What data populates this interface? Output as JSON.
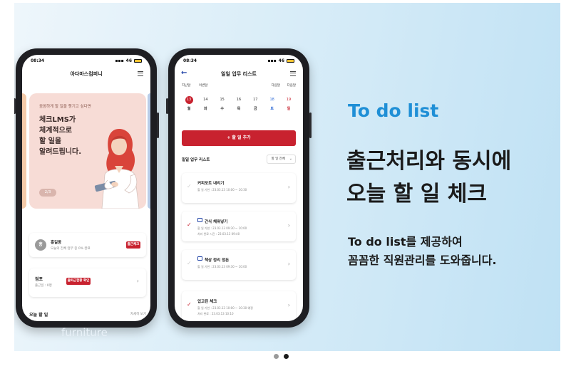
{
  "phone1": {
    "time": "08:34",
    "signal": "46",
    "app_title": "아다마스컴퍼니",
    "hero": {
      "small_text": "꼼꼼하게 할 일을 챙기고 싶다면",
      "big_text": "체크LMS가\n체계적으로\n할 일을\n알려드립니다.",
      "page": "2/3"
    },
    "clockin_card": {
      "avatar": "홍",
      "name": "홍길동",
      "sub": "오늘의 전체 업무 중 0% 완료",
      "button": "출근체크"
    },
    "dept_card": {
      "title": "점포",
      "sub": "출근일 : 0명",
      "button": "출퇴근현황 확인"
    },
    "today": {
      "title": "오늘 할 일",
      "more": "자세히 보기"
    }
  },
  "phone2": {
    "time": "08:34",
    "signal": "46",
    "title": "일일 업무 리스트",
    "nav": {
      "prev_week": "지난달",
      "this_week": "이번달",
      "next_week": "다음달",
      "next_month": "다음달"
    },
    "week": [
      {
        "num": "13",
        "dow": "월",
        "kind": "today"
      },
      {
        "num": "14",
        "dow": "화",
        "kind": ""
      },
      {
        "num": "15",
        "dow": "수",
        "kind": ""
      },
      {
        "num": "16",
        "dow": "목",
        "kind": ""
      },
      {
        "num": "17",
        "dow": "금",
        "kind": ""
      },
      {
        "num": "18",
        "dow": "토",
        "kind": "sat"
      },
      {
        "num": "19",
        "dow": "일",
        "kind": "sun"
      }
    ],
    "add_button": "+ 할 일 추가",
    "list_title": "일일 업무 리스트",
    "filter": "할 일 전체",
    "tasks": [
      {
        "title": "커피포트 내리기",
        "line1": "할 일 기한 : 23.03.13 10:00 ~ 10:30",
        "line2": "",
        "checked": false,
        "camera": false
      },
      {
        "title": "간식 채워넣기",
        "line1": "할 일 기한 : 23.03.13 09:30 ~ 10:00",
        "line2": "처리 완료 시간 : 23.03.13 09:40",
        "checked": true,
        "camera": true
      },
      {
        "title": "책상 정리 정돈",
        "line1": "할 일 기한 : 23.03.13 09:30 ~ 10:00",
        "line2": "",
        "checked": false,
        "camera": true
      },
      {
        "title": "입고된 체크",
        "line1": "할 일 기한 : 23.03.13 10:00 ~ 10:30 예정",
        "line2": "처리 완료 : 23.03.13 10:10",
        "checked": true,
        "camera": false
      }
    ]
  },
  "text": {
    "tag": "To do list",
    "headline_line1": "출근처리와 동시에",
    "headline_line2": "오늘 할 일 체크",
    "desc_line1": "To do list를 제공하여",
    "desc_line2": "꼼꼼한 직원관리를 도와줍니다."
  },
  "caption": "furniture",
  "pagination": {
    "count": 2,
    "active": 2
  },
  "colors": {
    "accent_red": "#c8222f",
    "tag_blue": "#1f8fd6",
    "bg_gradient_end": "#bfe1f4"
  }
}
